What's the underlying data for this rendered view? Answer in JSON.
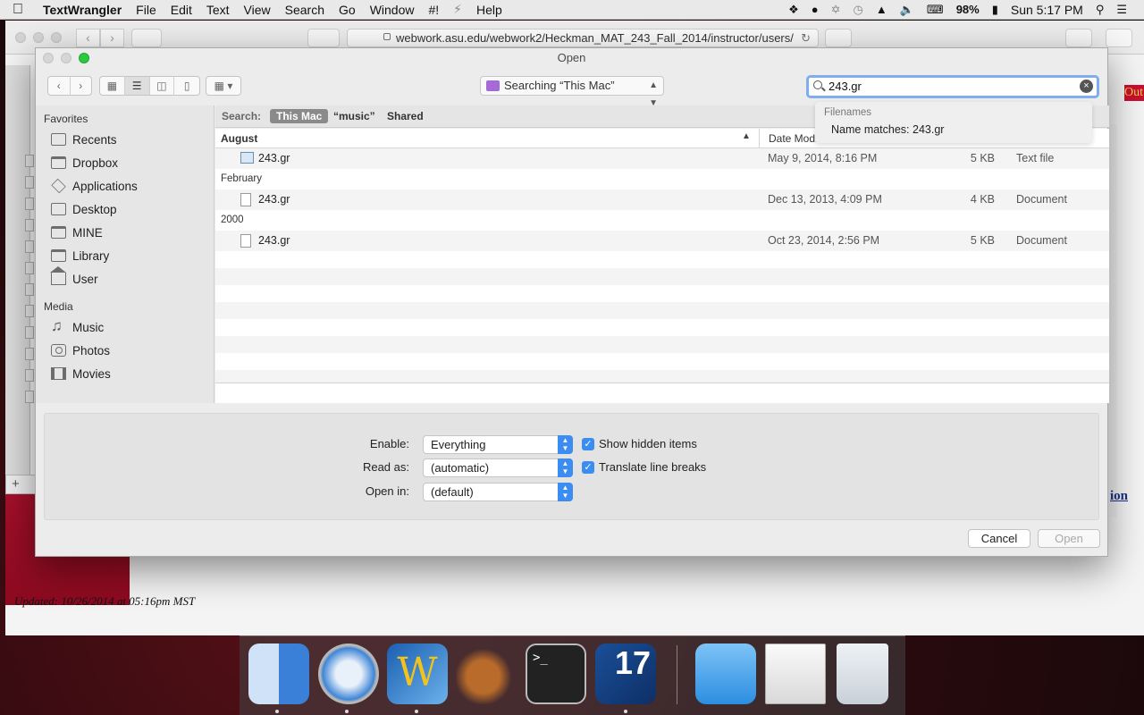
{
  "menubar": {
    "app": "TextWrangler",
    "items": [
      "File",
      "Edit",
      "Text",
      "View",
      "Search",
      "Go",
      "Window",
      "#!",
      "Help"
    ],
    "battery": "98%",
    "clock": "Sun 5:17 PM"
  },
  "browser": {
    "url": "webwork.asu.edu/webwork2/Heckman_MAT_243_Fall_2014/instructor/users/",
    "updated": "Updated: 10/26/2014 at 05:16pm MST",
    "right_link": "ion",
    "badge": "Out"
  },
  "dialog": {
    "title": "Open",
    "location": "Searching “This Mac”",
    "search_value": "243.gr",
    "suggest_header": "Filenames",
    "suggest_item": "Name matches: 243.gr",
    "sidebar": {
      "favorites_label": "Favorites",
      "favorites": [
        {
          "label": "Recents",
          "icon": "recents-icon"
        },
        {
          "label": "Dropbox",
          "icon": "folder-icon"
        },
        {
          "label": "Applications",
          "icon": "applications-icon"
        },
        {
          "label": "Desktop",
          "icon": "desktop-icon"
        },
        {
          "label": "MINE",
          "icon": "folder-icon"
        },
        {
          "label": "Library",
          "icon": "folder-icon"
        },
        {
          "label": "User",
          "icon": "home-icon"
        }
      ],
      "media_label": "Media",
      "media": [
        {
          "label": "Music",
          "icon": "music-icon"
        },
        {
          "label": "Photos",
          "icon": "camera-icon"
        },
        {
          "label": "Movies",
          "icon": "film-icon"
        }
      ]
    },
    "scope": {
      "label": "Search:",
      "this_mac": "This Mac",
      "music": "“music”",
      "shared": "Shared"
    },
    "columns": {
      "name": "August",
      "date": "Date Modified"
    },
    "groups": [
      {
        "label": "August",
        "files": [
          {
            "name": "243.gr",
            "date": "May 9, 2014, 8:16 PM",
            "size": "5 KB",
            "kind": "Text file"
          }
        ]
      },
      {
        "label": "February",
        "files": [
          {
            "name": "243.gr",
            "date": "Dec 13, 2013, 4:09 PM",
            "size": "4 KB",
            "kind": "Document"
          }
        ]
      },
      {
        "label": "2000",
        "files": [
          {
            "name": "243.gr",
            "date": "Oct 23, 2014, 2:56 PM",
            "size": "5 KB",
            "kind": "Document"
          }
        ]
      }
    ],
    "options": {
      "enable_label": "Enable:",
      "enable_value": "Everything",
      "readas_label": "Read as:",
      "readas_value": "(automatic)",
      "openin_label": "Open in:",
      "openin_value": "(default)",
      "show_hidden": "Show hidden items",
      "translate_breaks": "Translate line breaks"
    },
    "cancel": "Cancel",
    "open": "Open"
  },
  "dock": {
    "calendar_day": "17",
    "terminal_prompt": ">_"
  },
  "colors": {
    "accent": "#3b8df2",
    "search_focus": "#7eaef0",
    "brand_red": "#a50f2a"
  }
}
